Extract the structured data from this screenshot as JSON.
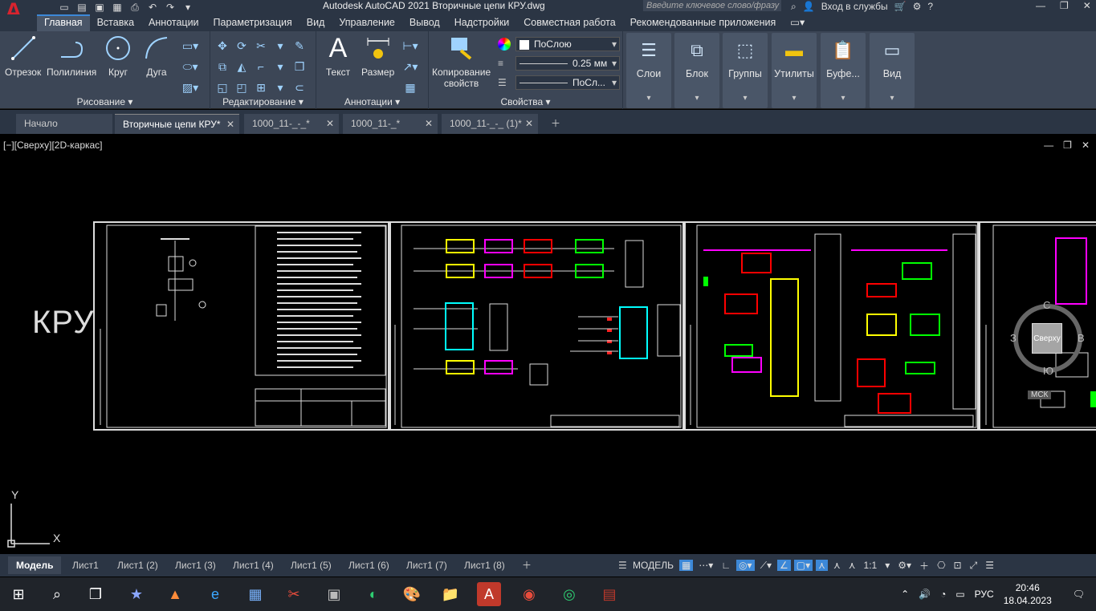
{
  "titlebar": {
    "app_logo": "A",
    "title": "Autodesk AutoCAD 2021    Вторичные цепи КРУ.dwg",
    "search_placeholder": "Введите ключевое слово/фразу",
    "signin": "Вход в службы"
  },
  "menu": {
    "items": [
      "Главная",
      "Вставка",
      "Аннотации",
      "Параметризация",
      "Вид",
      "Управление",
      "Вывод",
      "Надстройки",
      "Совместная работа",
      "Рекомендованные приложения"
    ]
  },
  "ribbon": {
    "draw": {
      "label": "Рисование ▾",
      "tools": [
        "Отрезок",
        "Полилиния",
        "Круг",
        "Дуга"
      ]
    },
    "modify": {
      "label": "Редактирование ▾"
    },
    "annotation": {
      "label": "Аннотации ▾",
      "tools": [
        "Текст",
        "Размер"
      ]
    },
    "properties": {
      "label": "Свойства ▾",
      "copy_props_line1": "Копирование",
      "copy_props_line2": "свойств",
      "color": "ПоСлою",
      "lineweight": "0.25 мм",
      "linetype": "ПоСл..."
    },
    "big_buttons": [
      "Слои",
      "Блок",
      "Группы",
      "Утилиты",
      "Буфе...",
      "Вид"
    ]
  },
  "doctabs": [
    {
      "label": "Начало",
      "closable": false
    },
    {
      "label": "Вторичные цепи КРУ*",
      "closable": true
    },
    {
      "label": "1000_11-_-_*",
      "closable": true
    },
    {
      "label": "1000_11-_*",
      "closable": true
    },
    {
      "label": "1000_11-_-_ (1)*",
      "closable": true
    }
  ],
  "viewport": {
    "label": "[−][Сверху][2D-каркас]",
    "drawing_title": "КРУ",
    "viewcube": {
      "top": "Сверху",
      "n": "С",
      "s": "Ю",
      "w": "З",
      "e": "В",
      "ucs": "МСК"
    },
    "axis_y": "Y",
    "axis_x": "X"
  },
  "layout_tabs": [
    "Модель",
    "Лист1",
    "Лист1 (2)",
    "Лист1 (3)",
    "Лист1 (4)",
    "Лист1 (5)",
    "Лист1 (6)",
    "Лист1 (7)",
    "Лист1 (8)"
  ],
  "statusbar": {
    "model": "МОДЕЛЬ",
    "scale": "1:1"
  },
  "taskbar": {
    "lang": "РУС",
    "time": "20:46",
    "date": "18.04.2023"
  }
}
